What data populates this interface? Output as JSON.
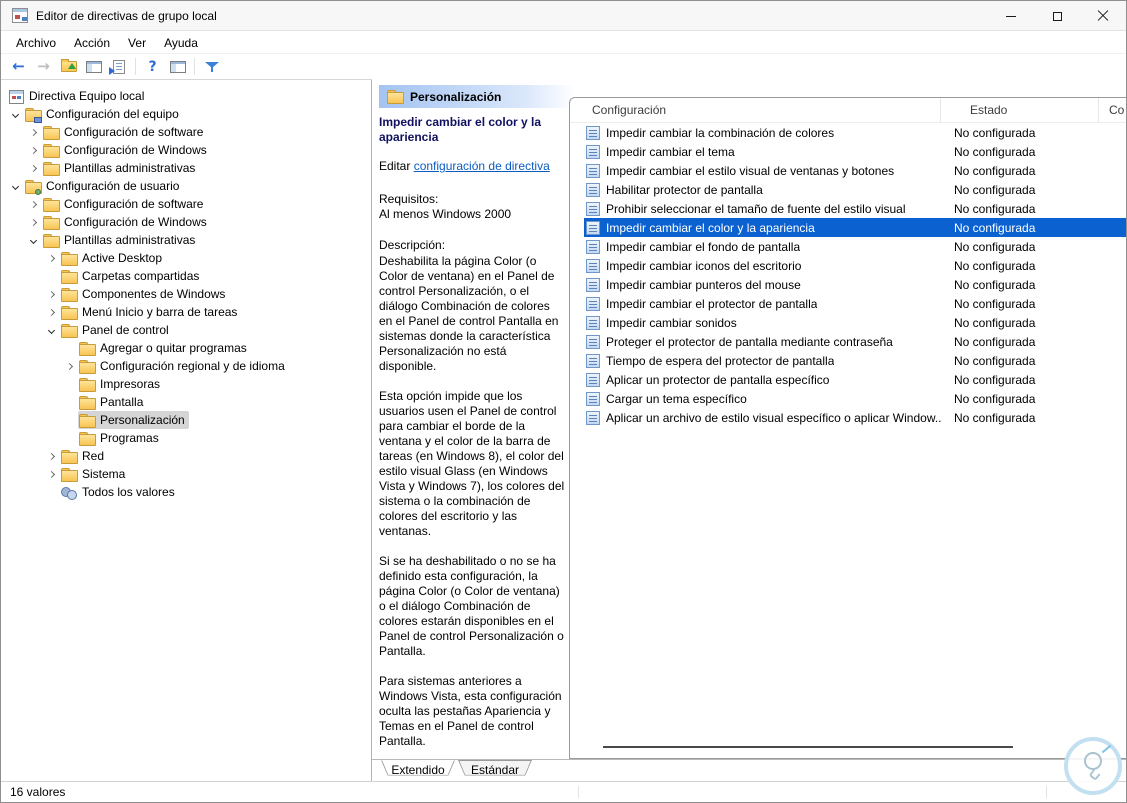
{
  "colors": {
    "selection_blue": "#0b61d0",
    "link_blue": "#0b5cc4",
    "title_navy": "#101060",
    "header_gradient": "#a3c3f1"
  },
  "icons": {
    "arrow_left": "←",
    "arrow_right": "→",
    "help": "?"
  },
  "window": {
    "title": "Editor de directivas de grupo local"
  },
  "menu": {
    "items": [
      "Archivo",
      "Acción",
      "Ver",
      "Ayuda"
    ]
  },
  "tree": {
    "items": [
      {
        "label": "Directiva Equipo local",
        "level": 0,
        "icon": "console",
        "state": "expanded",
        "selected": false
      },
      {
        "label": "Configuración del equipo",
        "level": 1,
        "icon": "computer-folder",
        "state": "expanded",
        "selected": false
      },
      {
        "label": "Configuración de software",
        "level": 2,
        "icon": "folder",
        "state": "collapsed",
        "selected": false
      },
      {
        "label": "Configuración de Windows",
        "level": 2,
        "icon": "folder",
        "state": "collapsed",
        "selected": false
      },
      {
        "label": "Plantillas administrativas",
        "level": 2,
        "icon": "folder",
        "state": "collapsed",
        "selected": false
      },
      {
        "label": "Configuración de usuario",
        "level": 1,
        "icon": "user-folder",
        "state": "expanded",
        "selected": false
      },
      {
        "label": "Configuración de software",
        "level": 2,
        "icon": "folder",
        "state": "collapsed",
        "selected": false
      },
      {
        "label": "Configuración de Windows",
        "level": 2,
        "icon": "folder",
        "state": "collapsed",
        "selected": false
      },
      {
        "label": "Plantillas administrativas",
        "level": 2,
        "icon": "folder",
        "state": "expanded",
        "selected": false
      },
      {
        "label": "Active Desktop",
        "level": 3,
        "icon": "folder",
        "state": "collapsed",
        "selected": false
      },
      {
        "label": "Carpetas compartidas",
        "level": 3,
        "icon": "folder",
        "state": "leaf",
        "selected": false
      },
      {
        "label": "Componentes de Windows",
        "level": 3,
        "icon": "folder",
        "state": "collapsed",
        "selected": false
      },
      {
        "label": "Menú Inicio y barra de tareas",
        "level": 3,
        "icon": "folder",
        "state": "collapsed",
        "selected": false
      },
      {
        "label": "Panel de control",
        "level": 3,
        "icon": "folder",
        "state": "expanded",
        "selected": false
      },
      {
        "label": "Agregar o quitar programas",
        "level": 4,
        "icon": "folder",
        "state": "leaf",
        "selected": false
      },
      {
        "label": "Configuración regional y de idioma",
        "level": 4,
        "icon": "folder",
        "state": "collapsed",
        "selected": false
      },
      {
        "label": "Impresoras",
        "level": 4,
        "icon": "folder",
        "state": "leaf",
        "selected": false
      },
      {
        "label": "Pantalla",
        "level": 4,
        "icon": "folder",
        "state": "leaf",
        "selected": false
      },
      {
        "label": "Personalización",
        "level": 4,
        "icon": "folder",
        "state": "leaf",
        "selected": true
      },
      {
        "label": "Programas",
        "level": 4,
        "icon": "folder",
        "state": "leaf",
        "selected": false
      },
      {
        "label": "Red",
        "level": 3,
        "icon": "folder",
        "state": "collapsed",
        "selected": false
      },
      {
        "label": "Sistema",
        "level": 3,
        "icon": "folder",
        "state": "collapsed",
        "selected": false
      },
      {
        "label": "Todos los valores",
        "level": 3,
        "icon": "all-values",
        "state": "leaf",
        "selected": false
      }
    ]
  },
  "detail_pane": {
    "header": "Personalización",
    "policy_title": "Impedir cambiar el color y la apariencia",
    "edit_prefix": "Editar ",
    "edit_link": "configuración de directiva",
    "requirements_label": "Requisitos:",
    "requirements_value": "Al menos Windows 2000",
    "description_label": "Descripción:",
    "paragraphs": [
      "Deshabilita la página Color (o Color de ventana) en el Panel de control Personalización, o el diálogo Combinación de colores en el Panel de control Pantalla en sistemas donde la característica Personalización no está disponible.",
      "Esta opción impide que los usuarios usen el Panel de control para cambiar el borde de la ventana y el color de la barra de tareas (en Windows 8), el color del estilo visual Glass (en Windows Vista y Windows 7), los colores del sistema o la combinación de colores del escritorio y las ventanas.",
      "Si se ha deshabilitado o no se ha definido esta configuración, la página Color (o Color de ventana) o el diálogo Combinación de colores estarán disponibles en el Panel de control Personalización o Pantalla.",
      "Para sistemas anteriores a Windows Vista, esta configuración oculta las pestañas Apariencia y Temas en el Panel de control Pantalla."
    ]
  },
  "list": {
    "columns": [
      {
        "label": "Configuración"
      },
      {
        "label": "Estado"
      },
      {
        "label": "Co"
      }
    ],
    "rows": [
      {
        "name": "Impedir cambiar la combinación de colores",
        "state": "No configurada",
        "selected": false
      },
      {
        "name": "Impedir cambiar el tema",
        "state": "No configurada",
        "selected": false
      },
      {
        "name": "Impedir cambiar el estilo visual de ventanas y botones",
        "state": "No configurada",
        "selected": false
      },
      {
        "name": "Habilitar protector de pantalla",
        "state": "No configurada",
        "selected": false
      },
      {
        "name": "Prohibir seleccionar el tamaño de fuente del estilo visual",
        "state": "No configurada",
        "selected": false
      },
      {
        "name": "Impedir cambiar el color y la apariencia",
        "state": "No configurada",
        "selected": true
      },
      {
        "name": "Impedir cambiar el fondo de pantalla",
        "state": "No configurada",
        "selected": false
      },
      {
        "name": "Impedir cambiar iconos del escritorio",
        "state": "No configurada",
        "selected": false
      },
      {
        "name": "Impedir cambiar punteros del mouse",
        "state": "No configurada",
        "selected": false
      },
      {
        "name": "Impedir cambiar el protector de pantalla",
        "state": "No configurada",
        "selected": false
      },
      {
        "name": "Impedir cambiar sonidos",
        "state": "No configurada",
        "selected": false
      },
      {
        "name": "Proteger el protector de pantalla mediante contraseña",
        "state": "No configurada",
        "selected": false
      },
      {
        "name": "Tiempo de espera del protector de pantalla",
        "state": "No configurada",
        "selected": false
      },
      {
        "name": "Aplicar un protector de pantalla específico",
        "state": "No configurada",
        "selected": false
      },
      {
        "name": "Cargar un tema específico",
        "state": "No configurada",
        "selected": false
      },
      {
        "name": "Aplicar un archivo de estilo visual específico o aplicar Window...",
        "state": "No configurada",
        "selected": false
      }
    ]
  },
  "tabs": [
    {
      "label": "Extendido",
      "active": true
    },
    {
      "label": "Estándar",
      "active": false
    }
  ],
  "status_bar": {
    "text": "16 valores"
  }
}
